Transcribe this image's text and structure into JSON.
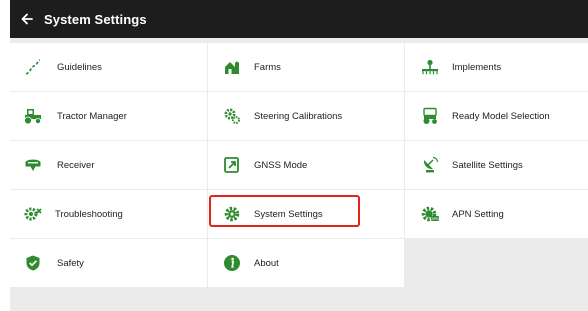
{
  "header": {
    "back_icon": "arrow-left-icon",
    "title": "System Settings"
  },
  "colors": {
    "accent_green": "#2e8b2e",
    "highlight_red": "#e0251f",
    "header_bg": "#1d1d1d"
  },
  "menu": [
    {
      "label": "Guidelines",
      "icon": "guidelines-icon"
    },
    {
      "label": "Farms",
      "icon": "farms-icon"
    },
    {
      "label": "Implements",
      "icon": "implements-icon"
    },
    {
      "label": "Tractor Manager",
      "icon": "tractor-icon"
    },
    {
      "label": "Steering Calibrations",
      "icon": "steering-gears-icon"
    },
    {
      "label": "Ready Model Selection",
      "icon": "ready-model-icon"
    },
    {
      "label": "Receiver",
      "icon": "receiver-icon"
    },
    {
      "label": "GNSS Mode",
      "icon": "gnss-mode-icon"
    },
    {
      "label": "Satellite Settings",
      "icon": "satellite-dish-icon"
    },
    {
      "label": "Troubleshooting",
      "icon": "troubleshooting-gear-icon"
    },
    {
      "label": "System Settings",
      "icon": "system-gear-icon",
      "selected": true
    },
    {
      "label": "APN Setting",
      "icon": "apn-gear-icon"
    },
    {
      "label": "Safety",
      "icon": "safety-shield-icon"
    },
    {
      "label": "About",
      "icon": "info-icon"
    }
  ]
}
